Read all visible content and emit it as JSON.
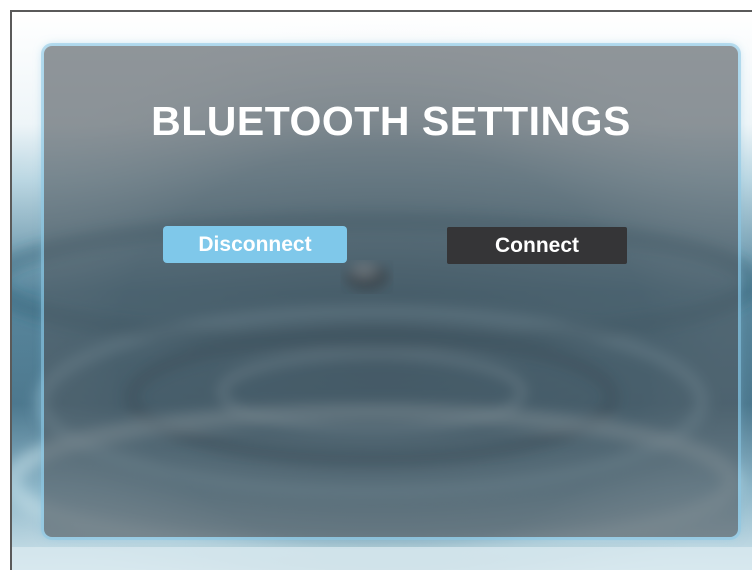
{
  "window": {
    "title": "BLUETOOTH SETTINGS"
  },
  "buttons": {
    "disconnect_label": "Disconnect",
    "connect_label": "Connect"
  },
  "colors": {
    "disconnect_bg": "#7fc8ea",
    "connect_bg": "#353537",
    "title_text": "#ffffff"
  }
}
